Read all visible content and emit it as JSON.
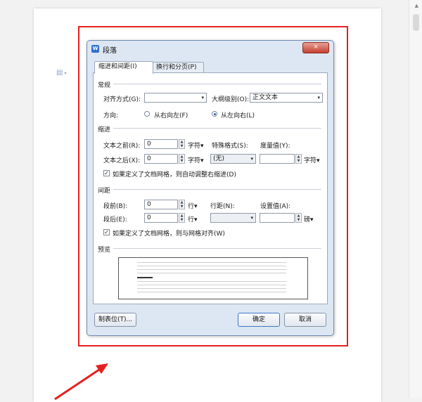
{
  "dialog": {
    "title": "段落",
    "close_label": "×",
    "title_icon": "W",
    "tabs": [
      {
        "label": "缩进和间距(I)",
        "active": true
      },
      {
        "label": "换行和分页(P)",
        "active": false
      }
    ]
  },
  "general": {
    "section_label": "常规",
    "alignment_label": "对齐方式(G):",
    "alignment_value": "",
    "outline_label": "大纲级别(O):",
    "outline_value": "正文文本",
    "direction_label": "方向:",
    "direction_rtl": "从右向左(F)",
    "direction_ltr": "从左向右(L)"
  },
  "indent": {
    "section_label": "缩进",
    "before_label": "文本之前(R):",
    "before_value": "0",
    "before_unit": "字符",
    "after_label": "文本之后(X):",
    "after_value": "0",
    "after_unit": "字符",
    "special_label": "特殊格式(S):",
    "special_value": "(无)",
    "measure_label": "度量值(Y):",
    "measure_value": "",
    "measure_unit": "字符",
    "auto_adjust_label": "如果定义了文档网格，则自动调整右缩进(D)",
    "auto_adjust_checked": true
  },
  "spacing": {
    "section_label": "间距",
    "before_label": "段前(B):",
    "before_value": "0",
    "before_unit": "行",
    "after_label": "段后(E):",
    "after_value": "0",
    "after_unit": "行",
    "line_label": "行距(N):",
    "line_value": "",
    "setting_label": "设置值(A):",
    "setting_value": "",
    "setting_unit": "磅",
    "snap_grid_label": "如果定义了文档网格，则与网格对齐(W)",
    "snap_grid_checked": true
  },
  "preview": {
    "section_label": "预览"
  },
  "footer": {
    "tabs_button": "制表位(T)...",
    "ok_button": "确定",
    "cancel_button": "取消"
  },
  "icons": {
    "document": "document-icon",
    "caret": "▾",
    "dropdown": "▾",
    "spin_up": "▲",
    "spin_down": "▼",
    "check": "✓",
    "scroll_up": "▲"
  },
  "colors": {
    "highlight_frame": "#e52020",
    "dialog_bg": "#dde7f3",
    "close_button": "#c4412f"
  }
}
